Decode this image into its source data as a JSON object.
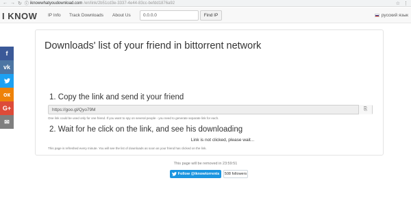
{
  "browser": {
    "back": "←",
    "forward": "→",
    "reload": "↻",
    "info": "ⓘ",
    "url_host": "iknowwhatyoudownload.com",
    "url_path": "/en/link/2b51cd3e-3337-4e44-83cc-befdd1876a92",
    "star_icon": "☆",
    "menu_icon": "⋮"
  },
  "navbar": {
    "brand": "I KNOW",
    "links": [
      "IP Info",
      "Track Downloads",
      "About Us"
    ],
    "ip_value": "0.0.0.0",
    "find_label": "Find IP",
    "language": "русский язык"
  },
  "social": {
    "items": [
      {
        "name": "facebook",
        "glyph": "f"
      },
      {
        "name": "vk",
        "glyph": "vk"
      },
      {
        "name": "twitter",
        "glyph": "t"
      },
      {
        "name": "odnoklassniki",
        "glyph": "ок"
      },
      {
        "name": "google-plus",
        "glyph": "G+"
      },
      {
        "name": "email",
        "glyph": "✉"
      }
    ]
  },
  "panel": {
    "title": "Downloads' list of your friend in bittorrent network",
    "step1_title": "1. Copy the link and send it your friend",
    "short_link": "https://goo.gl/Qyo79M",
    "copy_icon": "⎘",
    "step1_hint": "One link could be used only for one friend. If you want to spy on several people - you need to generate separate link for each.",
    "step2_title": "2. Wait for he click on the link, and see his downloading",
    "status_text": "Link is not clicked, please wait...",
    "step2_hint": "This page is refreshed every minute. You will see the list of downloads as soon as your friend has clicked on the link."
  },
  "footer": {
    "removal_text": "This page will be removed in 23:59:51",
    "follow_label": "Follow @iknowtorrents",
    "followers_label": "508 followers"
  },
  "colors": {
    "twitter_blue": "#1b95e0",
    "facebook": "#3b5998",
    "vk": "#4c75a3",
    "odnoklassniki": "#ee8208",
    "google_plus": "#dd4b39"
  }
}
